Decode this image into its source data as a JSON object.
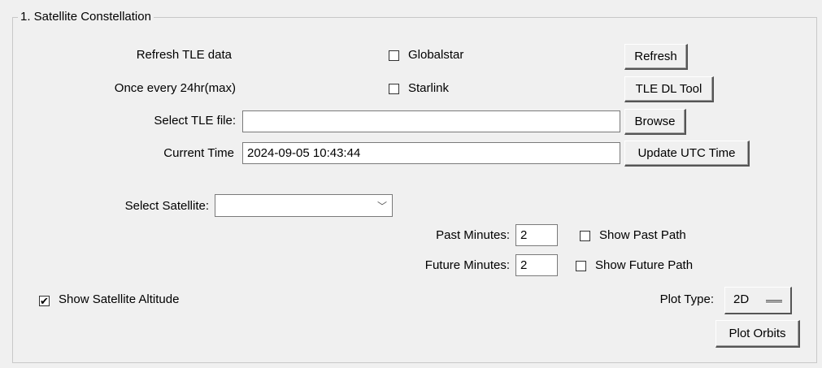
{
  "frame": {
    "title": "1. Satellite Constellation"
  },
  "tle": {
    "refresh_label": "Refresh TLE data",
    "refresh_note": "Once every 24hr(max)",
    "globalstar_label": "Globalstar",
    "starlink_label": "Starlink",
    "globalstar_checked": false,
    "starlink_checked": false,
    "refresh_button": "Refresh",
    "dl_tool_button": "TLE DL Tool",
    "file_label": "Select TLE file:",
    "file_value": "",
    "browse_button": "Browse"
  },
  "time": {
    "label": "Current Time",
    "value": "2024-09-05 10:43:44",
    "update_button": "Update UTC Time"
  },
  "satellite": {
    "label": "Select Satellite:",
    "selected": "",
    "arrow_icon": "chevron-down-icon"
  },
  "paths": {
    "past_label": "Past Minutes:",
    "past_value": "2",
    "show_past_label": "Show Past Path",
    "show_past_checked": false,
    "future_label": "Future Minutes:",
    "future_value": "2",
    "show_future_label": "Show Future Path",
    "show_future_checked": false
  },
  "altitude": {
    "label": "Show Satellite Altitude",
    "checked": true,
    "check_mark": "✔"
  },
  "plot": {
    "type_label": "Plot Type:",
    "type_value": "2D",
    "plot_button": "Plot Orbits"
  }
}
